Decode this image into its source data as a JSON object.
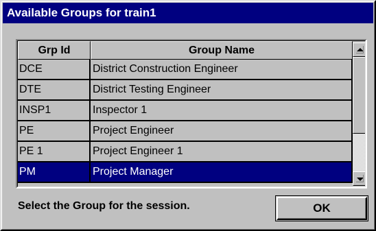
{
  "window": {
    "title": "Available Groups for train1"
  },
  "grid": {
    "columns": [
      {
        "label": "Grp Id"
      },
      {
        "label": "Group Name"
      }
    ],
    "rows": [
      {
        "id": "DCE",
        "name": "District Construction Engineer",
        "selected": false
      },
      {
        "id": "DTE",
        "name": "District Testing Engineer",
        "selected": false
      },
      {
        "id": "INSP1",
        "name": "Inspector 1",
        "selected": false
      },
      {
        "id": "PE",
        "name": "Project Engineer",
        "selected": false
      },
      {
        "id": "PE 1",
        "name": "Project Engineer 1",
        "selected": false
      },
      {
        "id": "PM",
        "name": "Project Manager",
        "selected": true
      }
    ],
    "scrollbar": {
      "up_icon": "arrow-up-icon",
      "down_icon": "arrow-down-icon"
    }
  },
  "footer": {
    "message": "Select the Group for the session.",
    "ok_label": "OK"
  },
  "colors": {
    "titlebar": "#000080",
    "selection": "#000080",
    "face": "#c0c0c0"
  }
}
